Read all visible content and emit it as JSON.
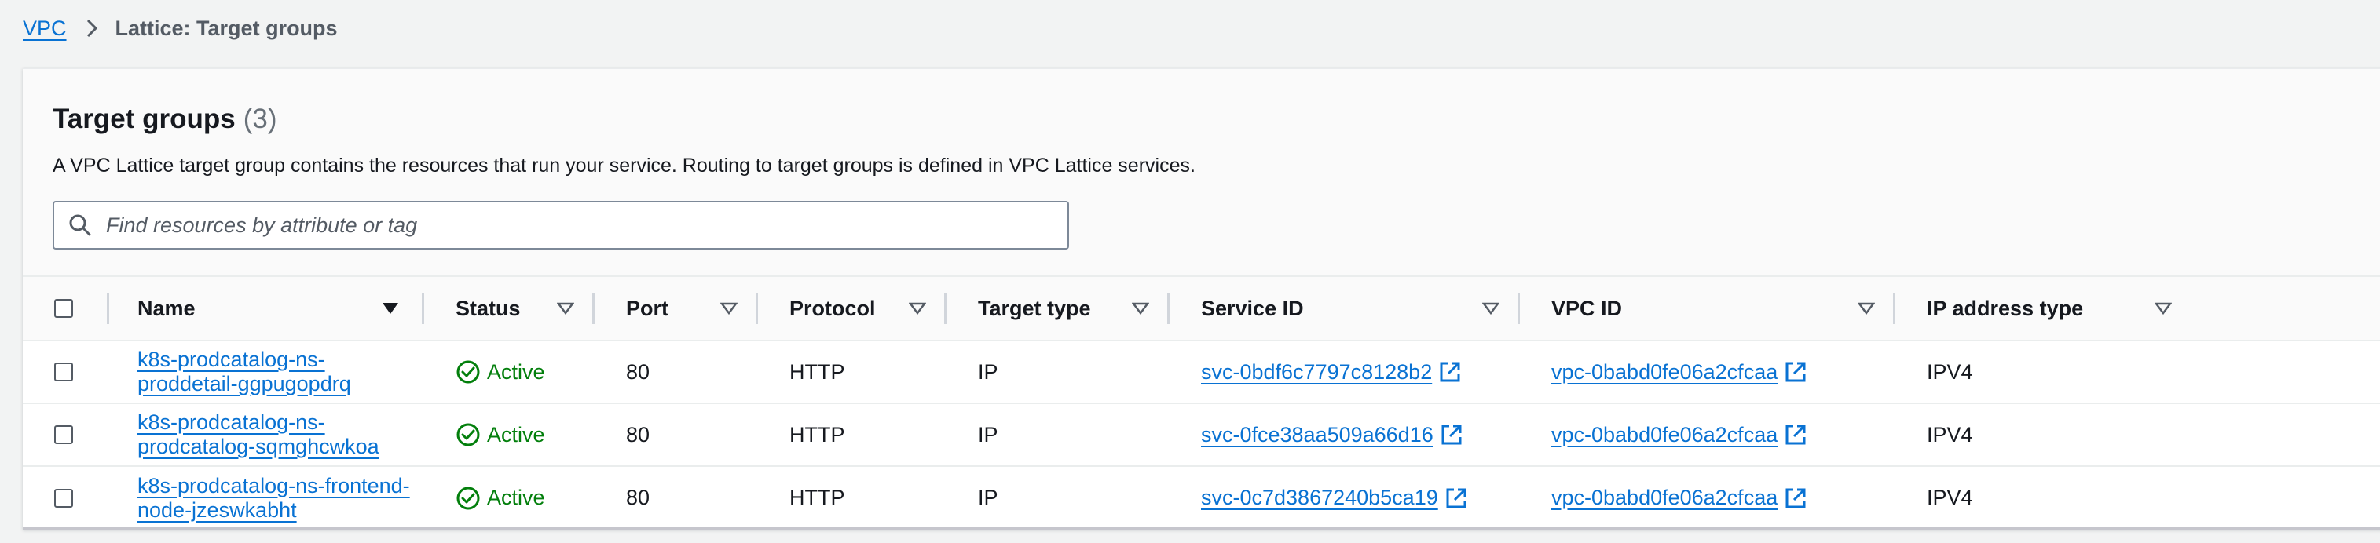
{
  "breadcrumb": {
    "root": "VPC",
    "current": "Lattice: Target groups"
  },
  "header": {
    "title": "Target groups",
    "count": "(3)",
    "description": "A VPC Lattice target group contains the resources that run your service. Routing to target groups is defined in VPC Lattice services."
  },
  "search": {
    "placeholder": "Find resources by attribute or tag",
    "value": ""
  },
  "columns": [
    "Name",
    "Status",
    "Port",
    "Protocol",
    "Target type",
    "Service ID",
    "VPC ID",
    "IP address type"
  ],
  "rows": [
    {
      "name": "k8s-prodcatalog-ns-proddetail-ggpugopdrq",
      "status": "Active",
      "port": "80",
      "protocol": "HTTP",
      "target_type": "IP",
      "service_id": "svc-0bdf6c7797c8128b2",
      "vpc_id": "vpc-0babd0fe06a2cfcaa",
      "ip_type": "IPV4"
    },
    {
      "name": "k8s-prodcatalog-ns-prodcatalog-sqmghcwkoa",
      "status": "Active",
      "port": "80",
      "protocol": "HTTP",
      "target_type": "IP",
      "service_id": "svc-0fce38aa509a66d16",
      "vpc_id": "vpc-0babd0fe06a2cfcaa",
      "ip_type": "IPV4"
    },
    {
      "name": "k8s-prodcatalog-ns-frontend-node-jzeswkabht",
      "status": "Active",
      "port": "80",
      "protocol": "HTTP",
      "target_type": "IP",
      "service_id": "svc-0c7d3867240b5ca19",
      "vpc_id": "vpc-0babd0fe06a2cfcaa",
      "ip_type": "IPV4"
    }
  ],
  "colors": {
    "link": "#0972d3",
    "success": "#037f0c",
    "text": "#16191f",
    "background": "#f2f3f3"
  },
  "icons": {
    "breadcrumb_separator": "chevron-right-icon",
    "search": "search-icon",
    "sort_active": "caret-down-filled-icon",
    "sort": "caret-down-outline-icon",
    "status_active": "check-circle-icon",
    "external_link": "external-link-icon"
  }
}
